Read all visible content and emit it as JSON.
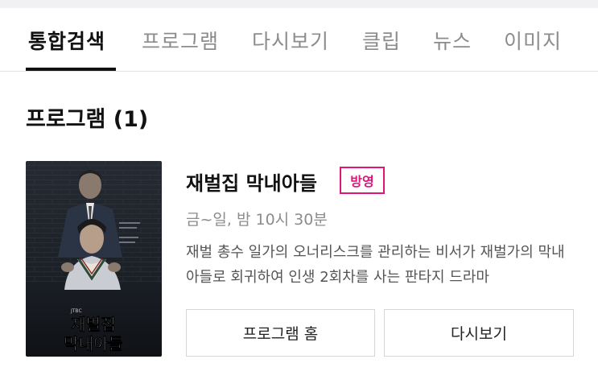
{
  "tabs": [
    {
      "label": "통합검색",
      "active": true
    },
    {
      "label": "프로그램",
      "active": false
    },
    {
      "label": "다시보기",
      "active": false
    },
    {
      "label": "클립",
      "active": false
    },
    {
      "label": "뉴스",
      "active": false
    },
    {
      "label": "이미지",
      "active": false
    }
  ],
  "section": {
    "title": "프로그램 (1)"
  },
  "program": {
    "title": "재벌집 막내아들",
    "badge": "방영",
    "schedule": "금~일, 밤 10시 30분",
    "description": "재벌 총수 일가의 오너리스크를 관리하는 비서가 재벌가의 막내아들로 회귀하여 인생 2회차를 사는 판타지 드라마",
    "poster": {
      "title_line1": "재벌집",
      "title_line2": "막내아들",
      "channel": "JTBC"
    }
  },
  "buttons": {
    "home": "프로그램 홈",
    "replay": "다시보기"
  },
  "colors": {
    "accent_badge": "#e0157a",
    "active_tab": "#111111",
    "inactive_tab": "#8c8c8c"
  }
}
